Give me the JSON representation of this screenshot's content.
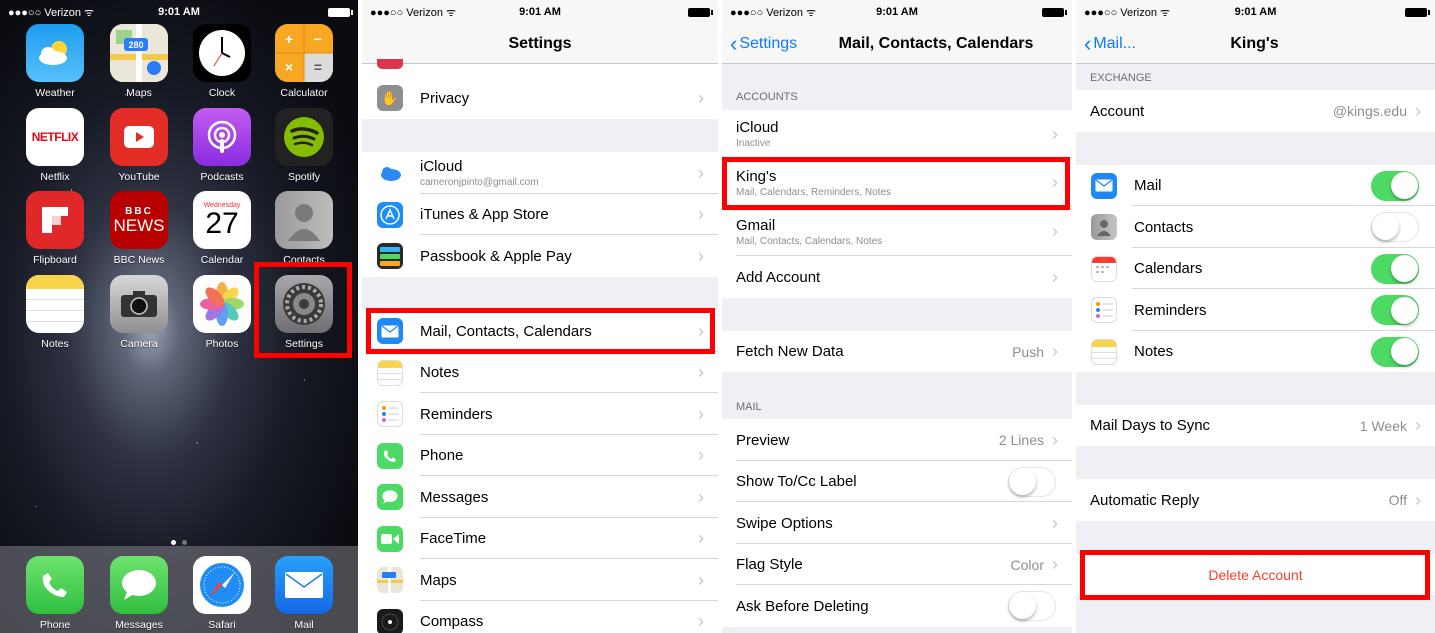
{
  "status": {
    "carrier": "●●●○○ Verizon ᯤ",
    "time": "9:01 AM"
  },
  "home": {
    "apps": [
      {
        "label": "Weather"
      },
      {
        "label": "Maps"
      },
      {
        "label": "Clock"
      },
      {
        "label": "Calculator"
      },
      {
        "label": "Netflix"
      },
      {
        "label": "YouTube"
      },
      {
        "label": "Podcasts"
      },
      {
        "label": "Spotify"
      },
      {
        "label": "Flipboard"
      },
      {
        "label": "BBC News"
      },
      {
        "label": "Calendar"
      },
      {
        "label": "Contacts"
      },
      {
        "label": "Notes"
      },
      {
        "label": "Camera"
      },
      {
        "label": "Photos"
      },
      {
        "label": "Settings"
      }
    ],
    "dock": [
      {
        "label": "Phone"
      },
      {
        "label": "Messages"
      },
      {
        "label": "Safari"
      },
      {
        "label": "Mail"
      }
    ],
    "icon_text": {
      "maps_route": "280",
      "netflix": "NETFLIX",
      "bbc_top": "BBC",
      "bbc_bottom": "NEWS",
      "cal_day": "Wednesday",
      "cal_date": "27"
    }
  },
  "settings": {
    "title": "Settings",
    "items": [
      {
        "label": "Privacy",
        "icon": "hand-icon",
        "color": "#8e8e93"
      },
      {
        "label": "iCloud",
        "sub": "cameronjpinto@gmail.com",
        "icon": "cloud-icon",
        "color": "#ffffff"
      },
      {
        "label": "iTunes & App Store",
        "icon": "app-store-icon",
        "color": "#1c8ef9"
      },
      {
        "label": "Passbook & Apple Pay",
        "icon": "passbook-icon",
        "color": "#2fb84a"
      },
      {
        "label": "Mail, Contacts, Calendars",
        "icon": "mail-icon",
        "color": "#1e88f5"
      },
      {
        "label": "Notes",
        "icon": "notes-icon",
        "color": "#ffffff"
      },
      {
        "label": "Reminders",
        "icon": "reminders-icon",
        "color": "#ffffff"
      },
      {
        "label": "Phone",
        "icon": "phone-icon",
        "color": "#4cd964"
      },
      {
        "label": "Messages",
        "icon": "messages-icon",
        "color": "#4cd964"
      },
      {
        "label": "FaceTime",
        "icon": "facetime-icon",
        "color": "#4cd964"
      },
      {
        "label": "Maps",
        "icon": "maps-icon",
        "color": "#e9e6d8"
      },
      {
        "label": "Compass",
        "icon": "compass-icon",
        "color": "#1a1a1a"
      }
    ]
  },
  "mcc": {
    "back": "Settings",
    "title": "Mail, Contacts, Calendars",
    "accounts_header": "ACCOUNTS",
    "accounts": [
      {
        "label": "iCloud",
        "sub": "Inactive"
      },
      {
        "label": "King's",
        "sub": "Mail, Calendars, Reminders, Notes"
      },
      {
        "label": "Gmail",
        "sub": "Mail, Contacts, Calendars, Notes"
      },
      {
        "label": "Add Account"
      }
    ],
    "fetch": {
      "label": "Fetch New Data",
      "value": "Push"
    },
    "mail_header": "MAIL",
    "mail_items": [
      {
        "label": "Preview",
        "value": "2 Lines",
        "type": "arrow"
      },
      {
        "label": "Show To/Cc Label",
        "type": "toggle",
        "on": false
      },
      {
        "label": "Swipe Options",
        "type": "arrow"
      },
      {
        "label": "Flag Style",
        "value": "Color",
        "type": "arrow"
      },
      {
        "label": "Ask Before Deleting",
        "type": "toggle",
        "on": false
      }
    ]
  },
  "kings": {
    "back": "Mail...",
    "title": "King's",
    "exchange_header": "EXCHANGE",
    "account": {
      "label": "Account",
      "value": "@kings.edu"
    },
    "services": [
      {
        "label": "Mail",
        "on": true
      },
      {
        "label": "Contacts",
        "on": false
      },
      {
        "label": "Calendars",
        "on": true
      },
      {
        "label": "Reminders",
        "on": true
      },
      {
        "label": "Notes",
        "on": true
      }
    ],
    "sync": {
      "label": "Mail Days to Sync",
      "value": "1 Week"
    },
    "reply": {
      "label": "Automatic Reply",
      "value": "Off"
    },
    "delete": "Delete Account"
  },
  "highlight_color": "#ff0000",
  "toggle_on_color": "#4cd964",
  "link_color": "#0a7aff"
}
